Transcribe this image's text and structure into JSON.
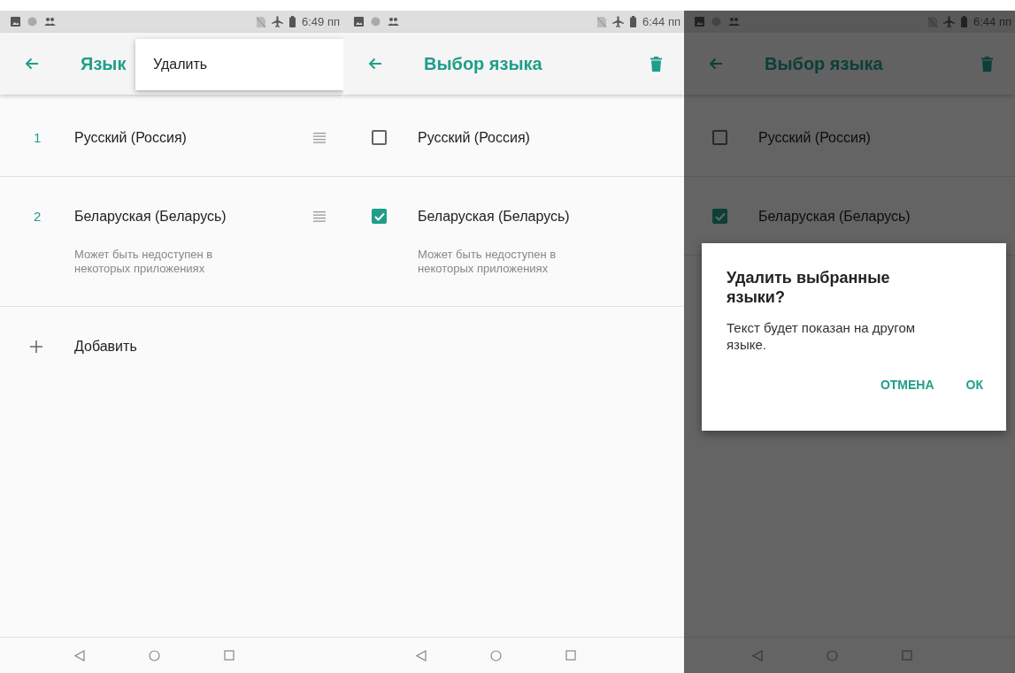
{
  "screens": [
    {
      "status_bar": {
        "time": "6:49 пп"
      },
      "app_bar": {
        "title": "Язык"
      },
      "dimmed": false,
      "languages": [
        {
          "kind": "numbered",
          "number": "1",
          "label": "Русский (Россия)"
        },
        {
          "kind": "numbered",
          "number": "2",
          "label": "Беларуская (Беларусь)",
          "subtitle": "Может быть недоступен в некоторых приложениях"
        }
      ],
      "add_item": {
        "label": "Добавить"
      },
      "menu": {
        "items": [
          {
            "label": "Удалить"
          }
        ]
      }
    },
    {
      "status_bar": {
        "time": "6:44 пп"
      },
      "app_bar": {
        "title": "Выбор языка",
        "show_delete": true
      },
      "dimmed": false,
      "languages": [
        {
          "kind": "checkbox",
          "label": "Русский (Россия)",
          "checked": false
        },
        {
          "kind": "checkbox",
          "label": "Беларуская (Беларусь)",
          "subtitle": "Может быть недоступен в некоторых приложениях",
          "checked": true
        }
      ]
    },
    {
      "status_bar": {
        "time": "6:44 пп"
      },
      "app_bar": {
        "title": "Выбор языка",
        "show_delete": true
      },
      "dimmed": true,
      "languages": [
        {
          "kind": "checkbox",
          "label": "Русский (Россия)",
          "checked": false
        },
        {
          "kind": "checkbox",
          "label": "Беларуская (Беларусь)",
          "checked": true
        }
      ],
      "dialog": {
        "title": "Удалить выбранные языки?",
        "message": "Текст будет показан на другом языке.",
        "buttons": [
          "ОТМЕНА",
          "ОК"
        ]
      }
    }
  ]
}
